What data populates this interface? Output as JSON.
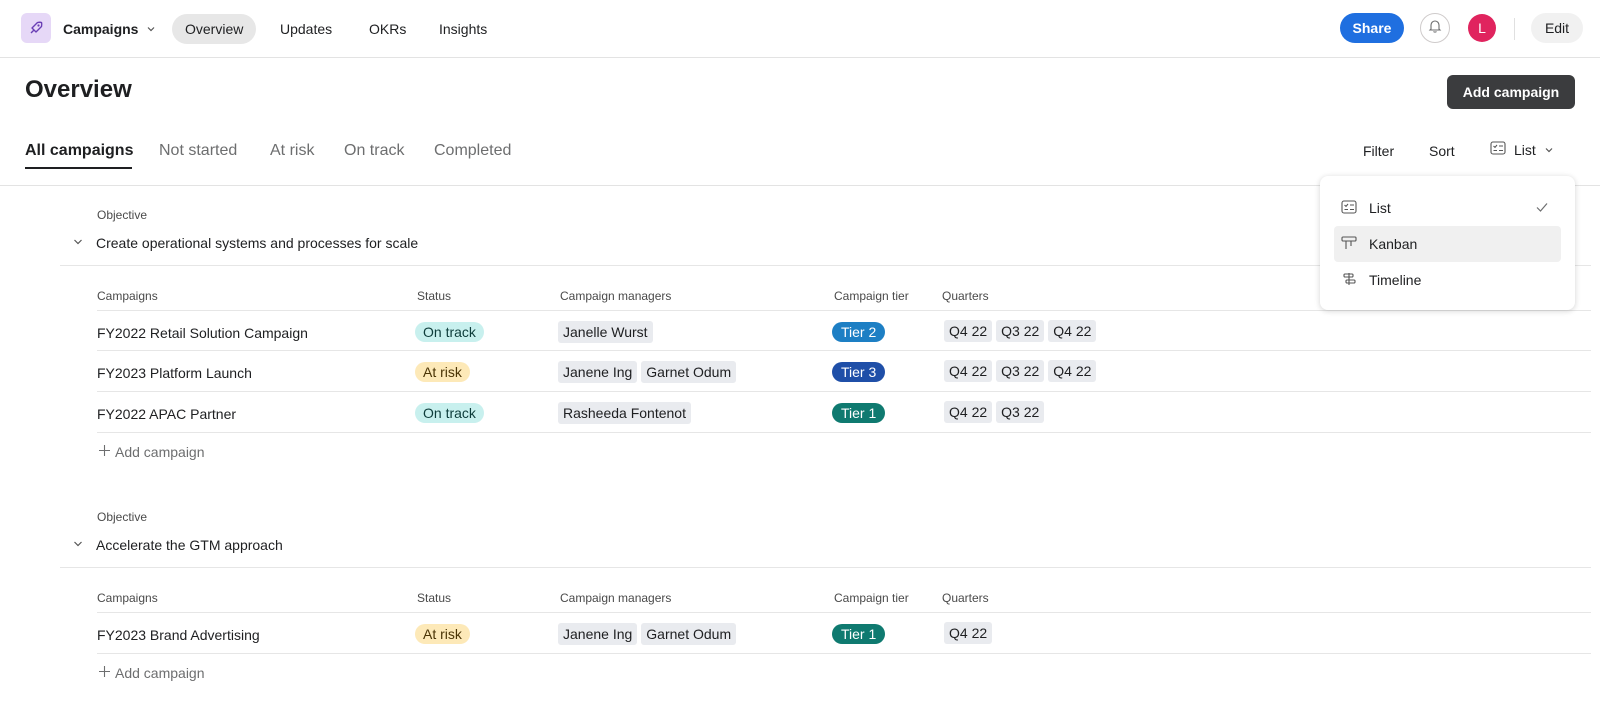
{
  "topbar": {
    "app_name": "Campaigns",
    "tabs": [
      "Overview",
      "Updates",
      "OKRs",
      "Insights"
    ],
    "share_label": "Share",
    "avatar_initial": "L",
    "edit_label": "Edit"
  },
  "header": {
    "title": "Overview",
    "add_campaign_label": "Add campaign",
    "filter_tabs": [
      "All campaigns",
      "Not started",
      "At risk",
      "On track",
      "Completed"
    ],
    "filter_label": "Filter",
    "sort_label": "Sort",
    "view_label": "List"
  },
  "columns": {
    "campaigns": "Campaigns",
    "status": "Status",
    "managers": "Campaign managers",
    "tier": "Campaign tier",
    "quarters": "Quarters"
  },
  "sections": [
    {
      "objective_label": "Objective",
      "objective_title": "Create operational systems and processes for scale",
      "rows": [
        {
          "name": "FY2022 Retail Solution Campaign",
          "status": "On track",
          "managers": [
            "Janelle Wurst"
          ],
          "tier": "Tier 2",
          "quarters": [
            "Q4 22",
            "Q3 22",
            "Q4 22"
          ]
        },
        {
          "name": "FY2023 Platform Launch",
          "status": "At risk",
          "managers": [
            "Janene Ing",
            "Garnet Odum"
          ],
          "tier": "Tier 3",
          "quarters": [
            "Q4 22",
            "Q3 22",
            "Q4 22"
          ]
        },
        {
          "name": "FY2022 APAC Partner",
          "status": "On track",
          "managers": [
            "Rasheeda Fontenot"
          ],
          "tier": "Tier 1",
          "quarters": [
            "Q4 22",
            "Q3 22"
          ]
        }
      ],
      "add_label": "Add campaign"
    },
    {
      "objective_label": "Objective",
      "objective_title": "Accelerate the GTM approach",
      "rows": [
        {
          "name": "FY2023 Brand Advertising",
          "status": "At risk",
          "managers": [
            "Janene Ing",
            "Garnet Odum"
          ],
          "tier": "Tier 1",
          "quarters": [
            "Q4 22"
          ]
        }
      ],
      "add_label": "Add campaign"
    }
  ],
  "view_menu": {
    "items": [
      "List",
      "Kanban",
      "Timeline"
    ],
    "selected": "List",
    "hovered": "Kanban"
  },
  "colors": {
    "share": "#1f6fe0",
    "avatar": "#e0245e",
    "tier_1": "#0f7a70",
    "tier_2": "#1d7fc4",
    "tier_3": "#1f4fa8",
    "on_track": "#c8f0ee",
    "at_risk": "#fde9b8"
  }
}
